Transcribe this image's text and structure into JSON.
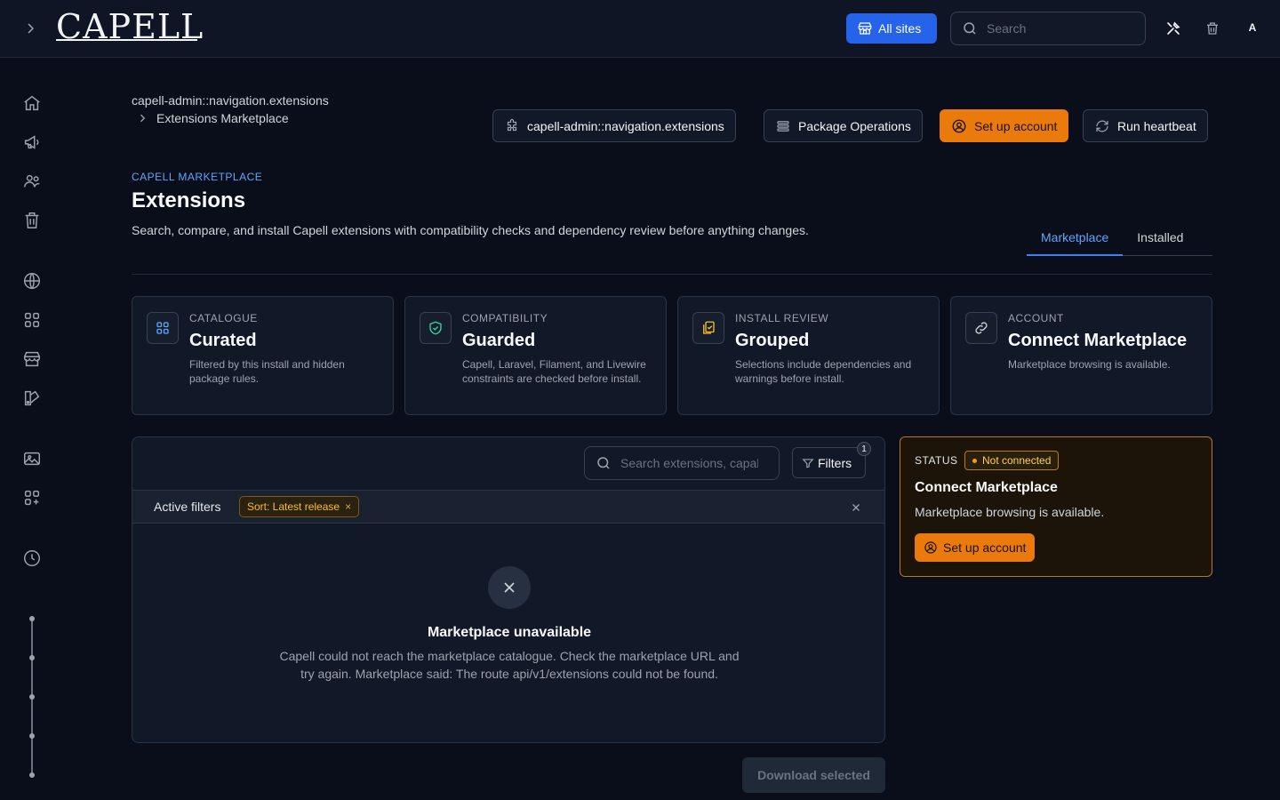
{
  "header": {
    "logo_text": "CAPELL",
    "all_sites_label": "All sites",
    "search_placeholder": "Search",
    "avatar_initial": "A"
  },
  "breadcrumb": {
    "parent": "capell-admin::navigation.extensions",
    "current": "Extensions Marketplace"
  },
  "actions": {
    "navigation_label": "capell-admin::navigation.extensions",
    "package_ops_label": "Package Operations",
    "setup_account_label": "Set up account",
    "heartbeat_label": "Run heartbeat"
  },
  "page": {
    "eyebrow": "CAPELL MARKETPLACE",
    "title": "Extensions",
    "description": "Search, compare, and install Capell extensions with compatibility checks and dependency review before anything changes."
  },
  "tabs": [
    {
      "label": "Marketplace",
      "active": true
    },
    {
      "label": "Installed",
      "active": false
    }
  ],
  "cards": [
    {
      "eyebrow": "CATALOGUE",
      "title": "Curated",
      "desc": "Filtered by this install and hidden package rules.",
      "icon": "grid-icon"
    },
    {
      "eyebrow": "COMPATIBILITY",
      "title": "Guarded",
      "desc": "Capell, Laravel, Filament, and Livewire constraints are checked before install.",
      "icon": "shield-check-icon"
    },
    {
      "eyebrow": "INSTALL REVIEW",
      "title": "Grouped",
      "desc": "Selections include dependencies and warnings before install.",
      "icon": "clipboard-check-icon"
    },
    {
      "eyebrow": "ACCOUNT",
      "title": "Connect Marketplace",
      "desc": "Marketplace browsing is available.",
      "icon": "link-icon"
    }
  ],
  "panel": {
    "search_placeholder": "Search extensions, capabilities",
    "filters_label": "Filters",
    "filters_count": "1",
    "active_filters_label": "Active filters",
    "chip_label": "Sort: Latest release",
    "chip_remove": "×",
    "empty_title": "Marketplace unavailable",
    "empty_desc": "Capell could not reach the marketplace catalogue. Check the marketplace URL and try again. Marketplace said: The route api/v1/extensions could not be found."
  },
  "status": {
    "eyebrow": "STATUS",
    "badge": "Not connected",
    "title": "Connect Marketplace",
    "desc": "Marketplace browsing is available.",
    "button_label": "Set up account"
  },
  "footer": {
    "download_label": "Download selected"
  },
  "colors": {
    "accent_blue": "#2563eb",
    "accent_orange": "#ea7a0b",
    "background": "#0a0e1a"
  }
}
